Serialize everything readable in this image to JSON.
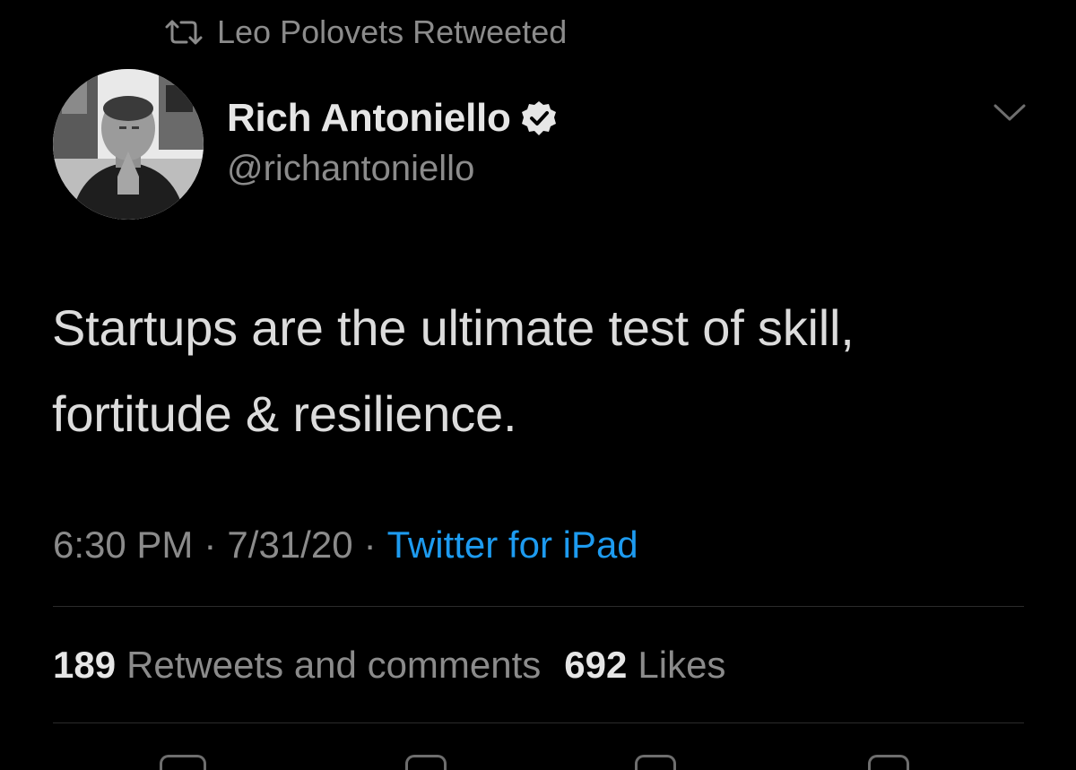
{
  "retweet": {
    "icon": "retweet-icon",
    "text": "Leo Polovets Retweeted"
  },
  "author": {
    "avatar": "avatar",
    "display_name": "Rich Antoniello",
    "verified_icon": "verified-badge-icon",
    "handle": "@richantoniello"
  },
  "menu": {
    "icon": "chevron-down-icon"
  },
  "tweet": {
    "line1": "Startups are the ultimate test of skill,",
    "line2": "fortitude & resilience."
  },
  "meta": {
    "time": "6:30 PM",
    "sep1": "·",
    "date": "7/31/20",
    "sep2": "·",
    "source": "Twitter for iPad"
  },
  "stats": {
    "retweets_count": "189",
    "retweets_label": "Retweets and comments",
    "likes_count": "692",
    "likes_label": "Likes"
  },
  "colors": {
    "background": "#000000",
    "primary_text": "#e6e6e6",
    "secondary_text": "#8b8b8b",
    "link": "#1d9bf0",
    "divider": "#2b2b2b"
  }
}
